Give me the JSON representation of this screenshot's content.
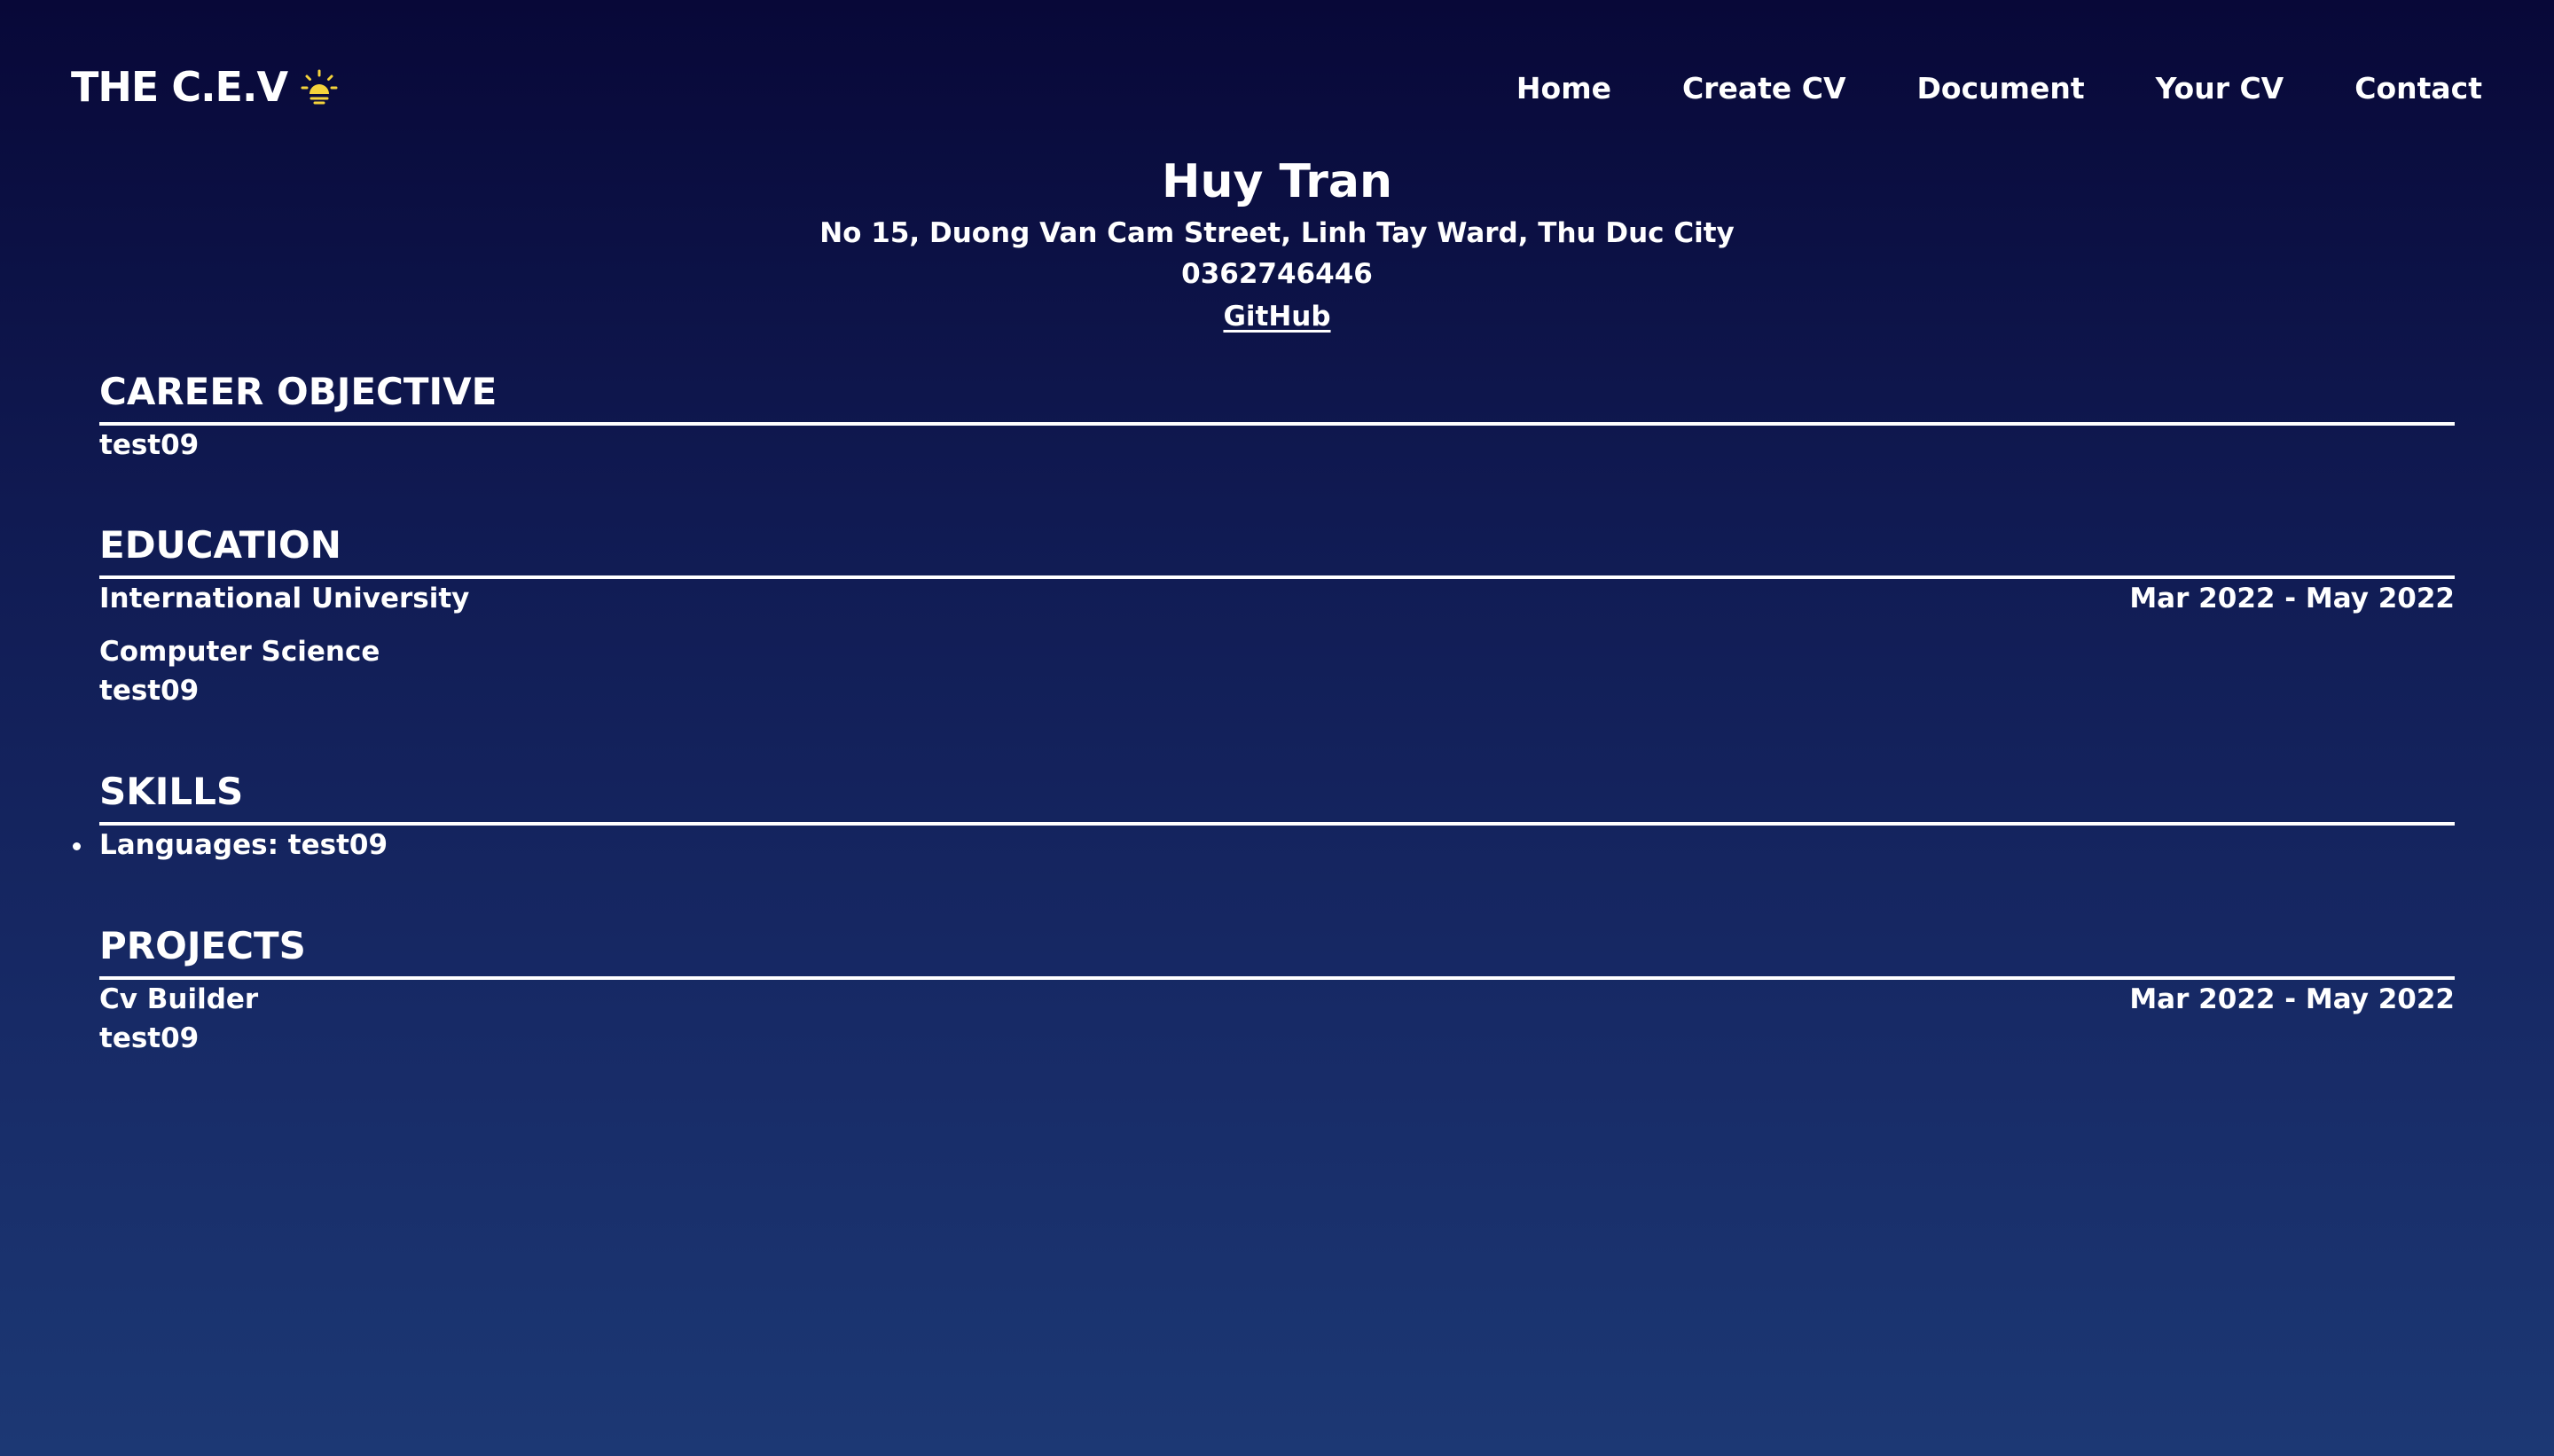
{
  "header": {
    "logo_text": "THE C.E.V",
    "logo_icon": "sun-icon",
    "nav": [
      "Home",
      "Create CV",
      "Document",
      "Your CV",
      "Contact"
    ]
  },
  "profile": {
    "name": "Huy Tran",
    "address": "No 15, Duong Van Cam Street, Linh Tay Ward, Thu Duc City",
    "phone": "0362746446",
    "github_label": "GitHub"
  },
  "sections": {
    "career_objective": {
      "title": "CAREER OBJECTIVE",
      "text": "test09"
    },
    "education": {
      "title": "EDUCATION",
      "school": "International University",
      "dates": "Mar 2022 - May 2022",
      "major": "Computer Science",
      "description": "test09"
    },
    "skills": {
      "title": "SKILLS",
      "items": [
        "Languages: test09"
      ]
    },
    "projects": {
      "title": "PROJECTS",
      "name": "Cv Builder",
      "dates": "Mar 2022 - May 2022",
      "description": "test09"
    }
  },
  "colors": {
    "background_top": "#080838",
    "background_bottom": "#1c3874",
    "text": "#ffffff",
    "logo_icon": "#f5d33b"
  }
}
